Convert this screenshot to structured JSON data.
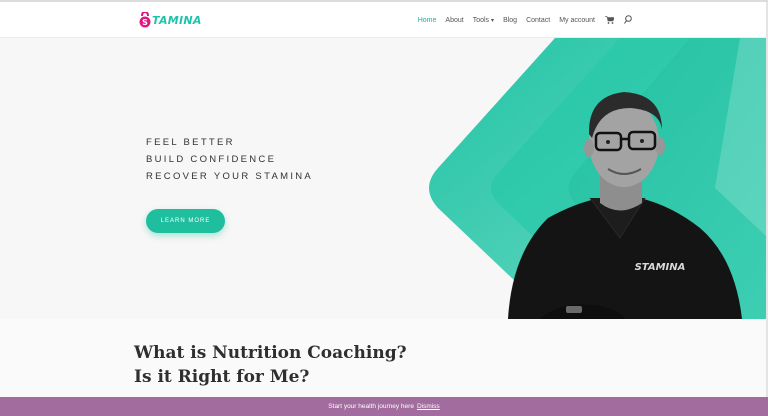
{
  "brand": {
    "name": "TAMINA",
    "logo_letter": "S",
    "accent": "#1fc3ad",
    "logo_accent": "#e2177f"
  },
  "nav": {
    "items": [
      {
        "label": "Home",
        "active": true
      },
      {
        "label": "About"
      },
      {
        "label": "Tools",
        "dropdown": true
      },
      {
        "label": "Blog"
      },
      {
        "label": "Contact"
      },
      {
        "label": "My account"
      }
    ],
    "icons": [
      "cart-icon",
      "search-icon"
    ]
  },
  "hero": {
    "taglines": [
      "FEEL BETTER",
      "BUILD CONFIDENCE",
      "RECOVER YOUR STAMINA"
    ],
    "cta_label": "LEARN MORE",
    "shirt_logo": "STAMINA",
    "colors": {
      "teal": "#1fbe9f",
      "teal_light": "#7fe0cd"
    }
  },
  "section": {
    "title_line1": "What is Nutrition Coaching?",
    "title_line2": "Is it Right for Me?"
  },
  "banner": {
    "text": "Start your health journey here",
    "dismiss": "Dismiss",
    "color": "#a26c9e"
  }
}
